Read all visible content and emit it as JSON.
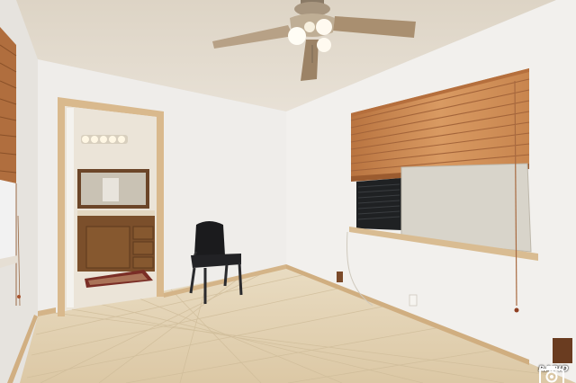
{
  "photo": {
    "subject": "empty-room-interior",
    "objects": [
      "ceiling-fan",
      "doorway-to-bathroom",
      "vanity-cabinet",
      "mirror",
      "vanity-light",
      "black-chair",
      "window-blinds",
      "window-ac-unit",
      "tile-floor",
      "baseboard",
      "left-window-blinds"
    ]
  },
  "watermark": {
    "text": "RAPID",
    "icon": "camera-icon"
  },
  "colors": {
    "ceiling": "#e4dccf",
    "wall_left": "#e9e6e2",
    "wall_back": "#f1efed",
    "wall_right": "#f3f1ef",
    "floor": "#e3d2b3",
    "trim": "#c9a57a",
    "blinds": "#c88a55",
    "ac_cover": "#d6d2c8",
    "chair": "#1b1b1d",
    "vanity": "#7b4f2b"
  }
}
